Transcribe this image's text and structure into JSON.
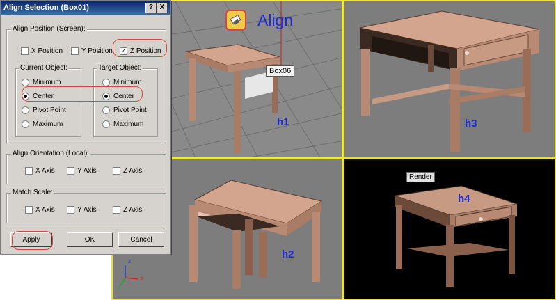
{
  "dialog": {
    "title": "Align Selection (Box01)",
    "help_btn": "?",
    "close_btn": "X",
    "align_position": {
      "title": "Align Position (Screen):",
      "x_label": "X Position",
      "y_label": "Y Position",
      "z_label": "Z Position",
      "z_checked": "✓"
    },
    "current_object": {
      "title": "Current Object:",
      "options": [
        "Minimum",
        "Center",
        "Pivot Point",
        "Maximum"
      ]
    },
    "target_object": {
      "title": "Target Object:",
      "options": [
        "Minimum",
        "Center",
        "Pivot Point",
        "Maximum"
      ]
    },
    "align_orientation": {
      "title": "Align Orientation (Local):",
      "x_label": "X Axis",
      "y_label": "Y Axis",
      "z_label": "Z Axis"
    },
    "match_scale": {
      "title": "Match Scale:",
      "x_label": "X Axis",
      "y_label": "Y Axis",
      "z_label": "Z Axis"
    },
    "buttons": {
      "apply": "Apply",
      "ok": "OK",
      "cancel": "Cancel"
    }
  },
  "viewports": {
    "align_label": "Align",
    "box_label": "Box06",
    "render_label": "Render",
    "h1": "h1",
    "h2": "h2",
    "h3": "h3",
    "h4": "h4",
    "axis": {
      "x": "x",
      "y": "y",
      "z": "z"
    }
  },
  "colors": {
    "active_border": "#f2ee3a",
    "label_blue": "#1d2bd6",
    "highlight_red": "#d4473e",
    "table_wood": "#c79a83"
  }
}
